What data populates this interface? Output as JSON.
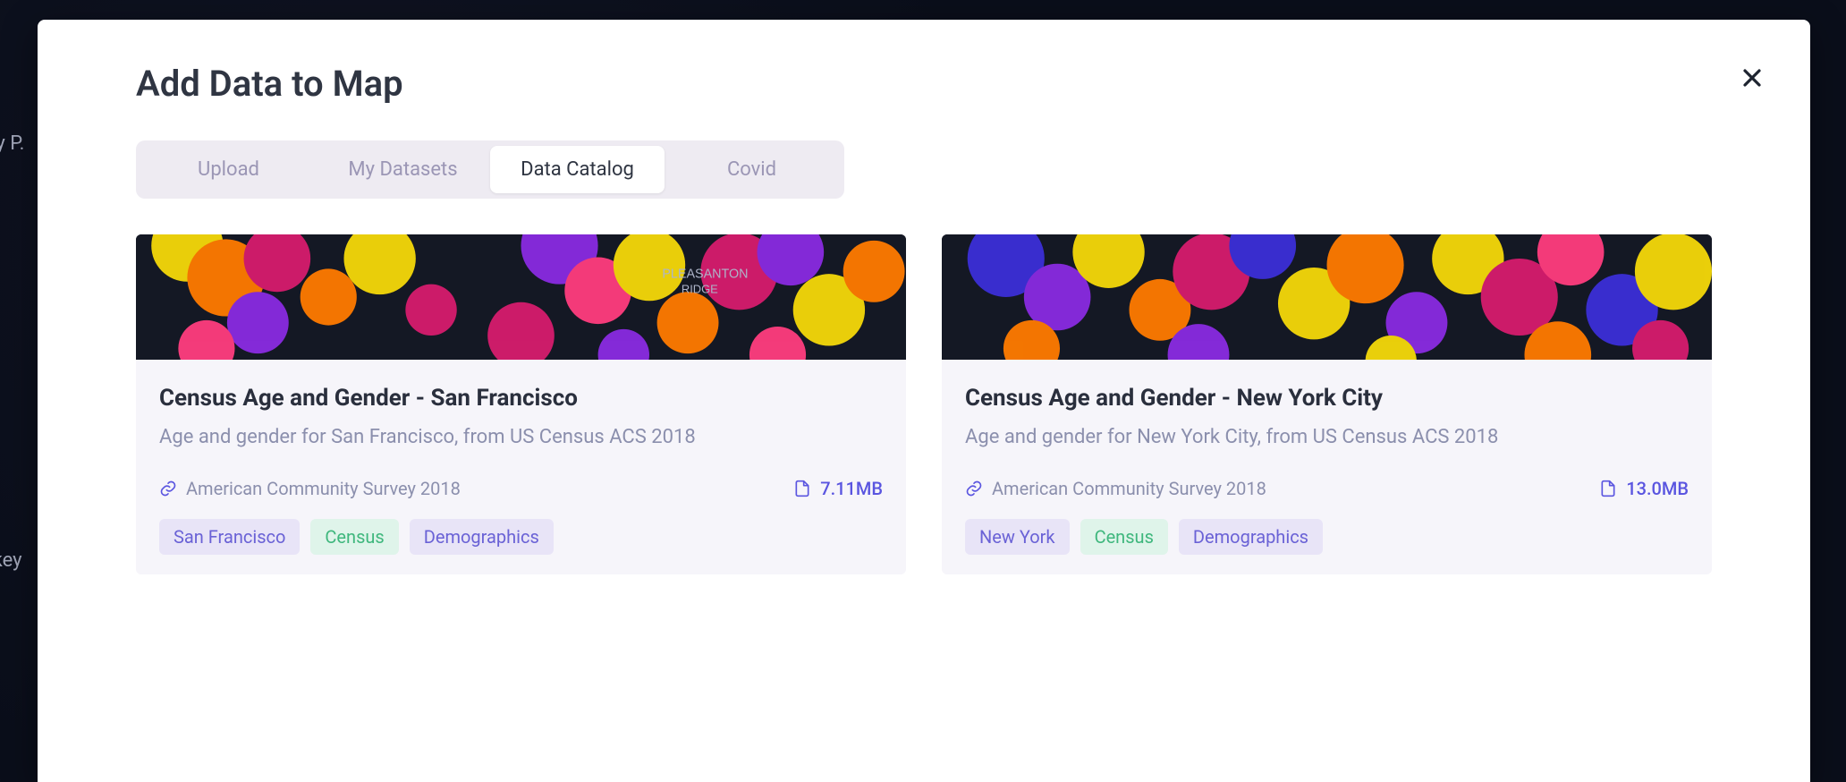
{
  "background": {
    "truncated_label_1": "ly P.",
    "truncated_label_2": "ekey"
  },
  "modal": {
    "title": "Add Data to Map",
    "tabs": [
      {
        "label": "Upload",
        "active": false
      },
      {
        "label": "My Datasets",
        "active": false
      },
      {
        "label": "Data Catalog",
        "active": true
      },
      {
        "label": "Covid",
        "active": false
      }
    ],
    "cards": [
      {
        "title": "Census Age and Gender - San Francisco",
        "description": "Age and gender for San Francisco, from US Census ACS 2018",
        "source": "American Community Survey 2018",
        "size": "7.11MB",
        "tags": [
          {
            "label": "San Francisco",
            "variant": "purple"
          },
          {
            "label": "Census",
            "variant": "green"
          },
          {
            "label": "Demographics",
            "variant": "purple"
          }
        ]
      },
      {
        "title": "Census Age and Gender - New York City",
        "description": "Age and gender for New York City, from US Census ACS 2018",
        "source": "American Community Survey 2018",
        "size": "13.0MB",
        "tags": [
          {
            "label": "New York",
            "variant": "purple"
          },
          {
            "label": "Census",
            "variant": "green"
          },
          {
            "label": "Demographics",
            "variant": "purple"
          }
        ]
      }
    ]
  }
}
